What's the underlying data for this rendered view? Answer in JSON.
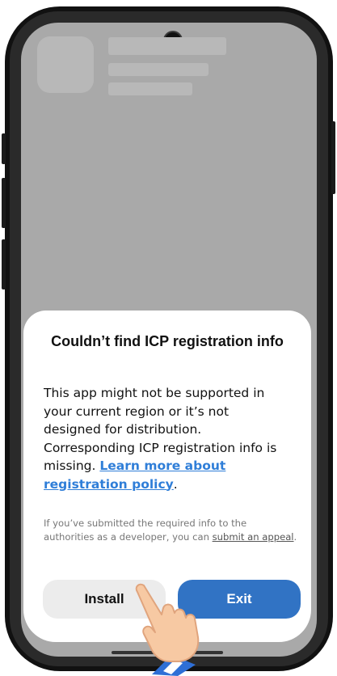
{
  "dialog": {
    "title": "Couldn’t find ICP registration info",
    "body_text": "This app might not be supported in your current region or it’s not designed for distribution. Corresponding ICP registration info is missing. ",
    "body_link": "Learn more about registration policy",
    "body_end": ".",
    "note_text": "If you’ve submitted the required info to the authorities as a developer, you can ",
    "note_link": "submit an appeal",
    "note_end": ".",
    "install_label": "Install",
    "exit_label": "Exit"
  },
  "colors": {
    "accent": "#3173c4",
    "link": "#2f7ed8",
    "overlay": "#a9a9a9"
  },
  "icons": {
    "pointer": "pointing-hand-icon"
  }
}
